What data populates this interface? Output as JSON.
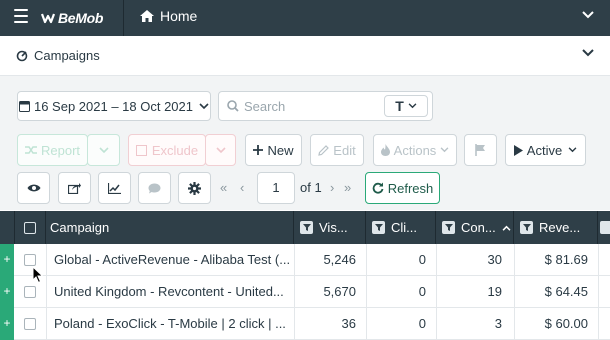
{
  "topbar": {
    "logo_text": "BeMob",
    "nav_label": "Home"
  },
  "subbar": {
    "title": "Campaigns"
  },
  "toolbar": {
    "date_range": "16 Sep 2021 – 18 Oct 2021",
    "search_placeholder": "Search",
    "search_type_glyph": "T",
    "report_label": "Report",
    "exclude_label": "Exclude",
    "new_label": "New",
    "edit_label": "Edit",
    "actions_label": "Actions",
    "status_filter": "Active",
    "page_current": "1",
    "page_of": "of 1",
    "refresh_label": "Refresh"
  },
  "table": {
    "columns": [
      "Campaign",
      "Vis...",
      "Cli...",
      "Con...",
      "Reve..."
    ],
    "rows": [
      {
        "campaign": "Global - ActiveRevenue - Alibaba Test (...",
        "visits": "5,246",
        "clicks": "0",
        "conversions": "30",
        "revenue": "$ 81.69"
      },
      {
        "campaign": "United Kingdom - Revcontent - United...",
        "visits": "5,670",
        "clicks": "0",
        "conversions": "19",
        "revenue": "$ 64.45"
      },
      {
        "campaign": "Poland - ExoClick - T-Mobile | 2 click | ...",
        "visits": "36",
        "clicks": "0",
        "conversions": "3",
        "revenue": "$ 60.00"
      }
    ],
    "row_expand_glyph": "+"
  },
  "colors": {
    "topbar": "#2f3f48",
    "accent_green": "#2aa978"
  }
}
